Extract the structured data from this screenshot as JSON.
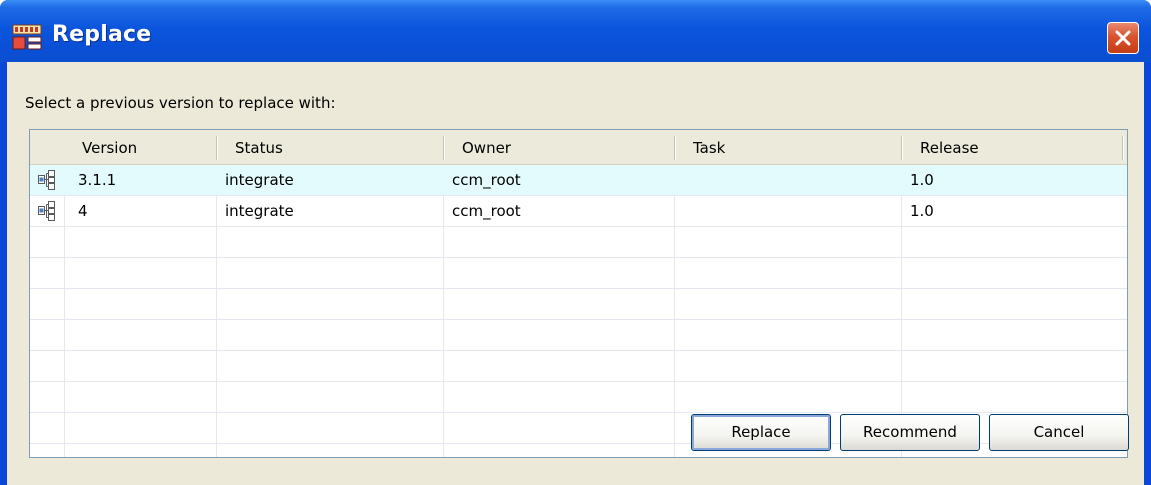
{
  "window": {
    "title": "Replace",
    "app_icon": "replace-app-icon",
    "close_icon": "close-icon"
  },
  "dialog": {
    "prompt": "Select a previous version to replace with:"
  },
  "table": {
    "columns": [
      "Version",
      "Status",
      "Owner",
      "Task",
      "Release"
    ],
    "rows": [
      {
        "icon": "object-version-icon",
        "version": "3.1.1",
        "status": "integrate",
        "owner": "ccm_root",
        "task": "",
        "release": "1.0",
        "selected": true
      },
      {
        "icon": "object-version-icon",
        "version": "4",
        "status": "integrate",
        "owner": "ccm_root",
        "task": "",
        "release": "1.0",
        "selected": false
      }
    ]
  },
  "buttons": {
    "replace": "Replace",
    "recommend": "Recommend",
    "cancel": "Cancel"
  },
  "colors": {
    "titlebar": "#0a4fd6",
    "close_button": "#d9532f",
    "dialog_bg": "#ece9d8",
    "selected_row": "#e3fbfd"
  }
}
